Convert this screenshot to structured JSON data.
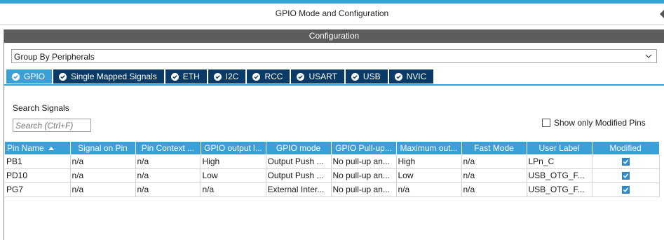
{
  "window": {
    "title": "GPIO Mode and Configuration"
  },
  "config": {
    "header": "Configuration"
  },
  "group_select": {
    "value": "Group By Peripherals"
  },
  "tabs": [
    {
      "label": "GPIO",
      "active": true
    },
    {
      "label": "Single Mapped Signals",
      "active": false
    },
    {
      "label": "ETH",
      "active": false
    },
    {
      "label": "I2C",
      "active": false
    },
    {
      "label": "RCC",
      "active": false
    },
    {
      "label": "USART",
      "active": false
    },
    {
      "label": "USB",
      "active": false
    },
    {
      "label": "NVIC",
      "active": false
    }
  ],
  "search": {
    "label": "Search Signals",
    "placeholder": "Search (Ctrl+F)"
  },
  "show_modified": {
    "label": "Show only Modified Pins",
    "checked": false
  },
  "table": {
    "headers": [
      "Pin Name",
      "Signal on Pin",
      "Pin Context ...",
      "GPIO output l...",
      "GPIO mode",
      "GPIO Pull-up...",
      "Maximum out...",
      "Fast Mode",
      "User Label",
      "Modified"
    ],
    "rows": [
      {
        "pin": "PB1",
        "signal": "n/a",
        "context": "n/a",
        "output": "High",
        "mode": "Output Push ...",
        "pull": "No pull-up an...",
        "max": "High",
        "fast": "n/a",
        "label": "LPn_C",
        "modified": true
      },
      {
        "pin": "PD10",
        "signal": "n/a",
        "context": "n/a",
        "output": "Low",
        "mode": "Output Push ...",
        "pull": "No pull-up an...",
        "max": "Low",
        "fast": "n/a",
        "label": "USB_OTG_F...",
        "modified": true
      },
      {
        "pin": "PG7",
        "signal": "n/a",
        "context": "n/a",
        "output": "n/a",
        "mode": "External Inter...",
        "pull": "No pull-up an...",
        "max": "n/a",
        "fast": "n/a",
        "label": "USB_OTG_F...",
        "modified": true
      }
    ]
  },
  "colors": {
    "accent": "#3aa0d8",
    "tab_bg": "#0a3a66",
    "header_bar": "#5c5c5c"
  }
}
